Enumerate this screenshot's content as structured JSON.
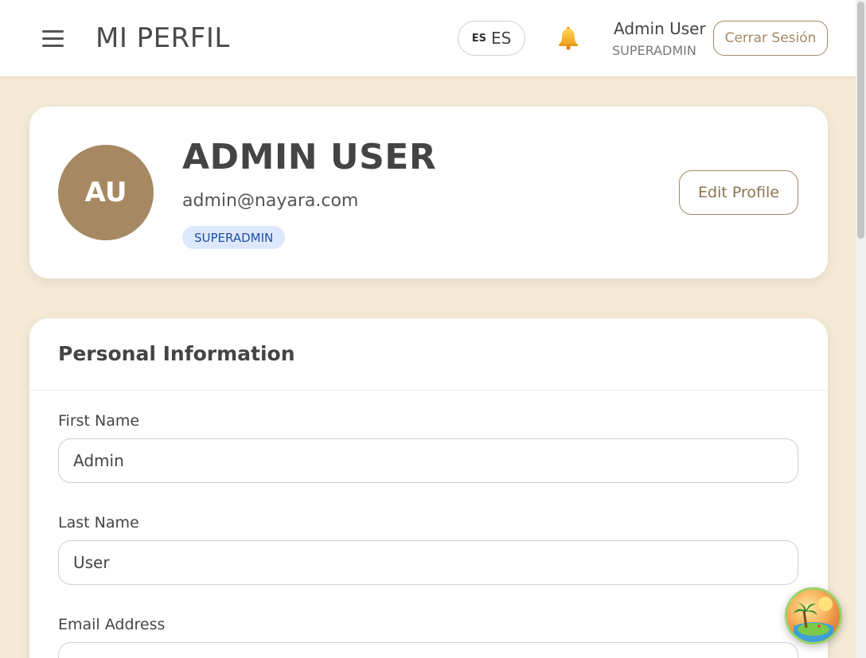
{
  "header": {
    "title": "MI PERFIL",
    "language": {
      "code_small": "ES",
      "code": "ES"
    },
    "user_name": "Admin User",
    "user_role": "SUPERADMIN",
    "logout_label": "Cerrar Sesión"
  },
  "profile": {
    "initials": "AU",
    "name": "ADMIN USER",
    "email": "admin@nayara.com",
    "role": "SUPERADMIN",
    "edit_label": "Edit Profile"
  },
  "personal_info": {
    "title": "Personal Information",
    "fields": [
      {
        "label": "First Name",
        "value": "Admin"
      },
      {
        "label": "Last Name",
        "value": "User"
      },
      {
        "label": "Email Address",
        "value": ""
      }
    ]
  },
  "colors": {
    "accent": "#a68962",
    "background": "#f5ead6",
    "badge_bg": "#dde9fb",
    "badge_text": "#1e4fa8"
  },
  "icons": {
    "menu": "hamburger-menu-icon",
    "notifications": "bell-icon",
    "chat": "island-chat-icon"
  }
}
